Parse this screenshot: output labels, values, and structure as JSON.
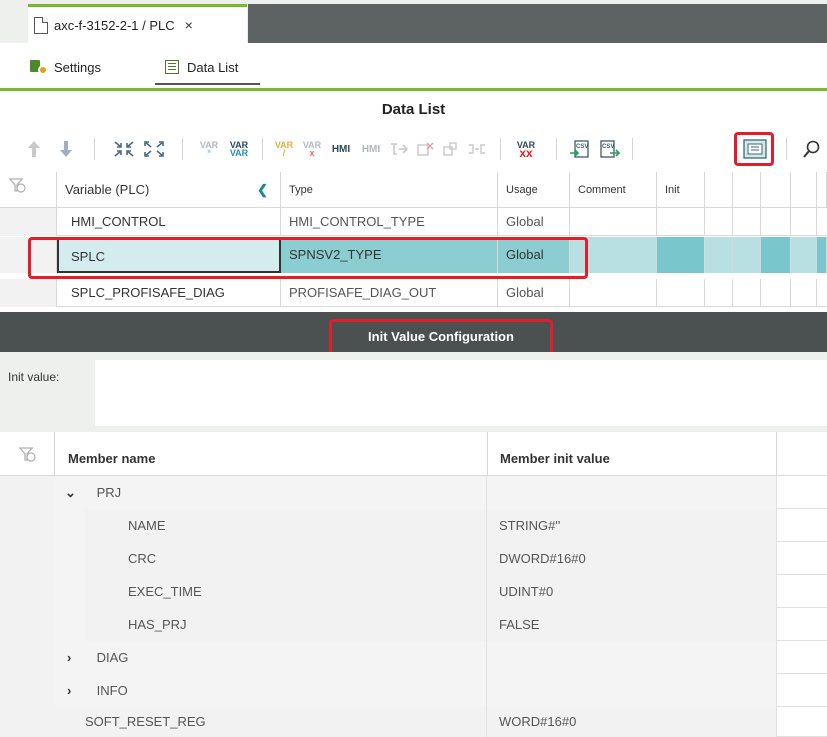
{
  "window": {
    "tab_title": "axc-f-3152-2-1 / PLC",
    "tab_close": "×"
  },
  "subtabs": {
    "settings": "Settings",
    "data_list": "Data List"
  },
  "data_list": {
    "title": "Data List",
    "toolbar": {
      "var": "VAR",
      "hmi": "HMI",
      "csv": "CSV"
    },
    "columns": {
      "variable": "Variable (PLC)",
      "type": "Type",
      "usage": "Usage",
      "comment": "Comment",
      "init": "Init"
    },
    "rows": [
      {
        "variable": "HMI_CONTROL",
        "type": "HMI_CONTROL_TYPE",
        "usage": "Global"
      },
      {
        "variable": "SPLC",
        "type": "SPNSV2_TYPE",
        "usage": "Global"
      },
      {
        "variable": "SPLC_PROFISAFE_DIAG",
        "type": "PROFISAFE_DIAG_OUT",
        "usage": "Global"
      }
    ],
    "selected_row": "SPLC"
  },
  "init_config": {
    "title": "Init Value Configuration",
    "init_label": "Init value:",
    "columns": {
      "member_name": "Member name",
      "member_init_value": "Member init value"
    },
    "members": [
      {
        "name": "PRJ",
        "value": "",
        "expander": "⌄",
        "level": 0
      },
      {
        "name": "NAME",
        "value": "STRING#''",
        "level": 1
      },
      {
        "name": "CRC",
        "value": "DWORD#16#0",
        "level": 1
      },
      {
        "name": "EXEC_TIME",
        "value": "UDINT#0",
        "level": 1
      },
      {
        "name": "HAS_PRJ",
        "value": "FALSE",
        "level": 1
      },
      {
        "name": "DIAG",
        "value": "",
        "expander": "›",
        "level": 0
      },
      {
        "name": "INFO",
        "value": "",
        "expander": "›",
        "level": 0
      },
      {
        "name": "SOFT_RESET_REG",
        "value": "WORD#16#0",
        "level": 0
      }
    ]
  },
  "colors": {
    "accent_green": "#7ab82e",
    "highlight_red": "#e31e2a",
    "selected_teal": "#79c7cc",
    "header_dark": "#4b5050"
  }
}
